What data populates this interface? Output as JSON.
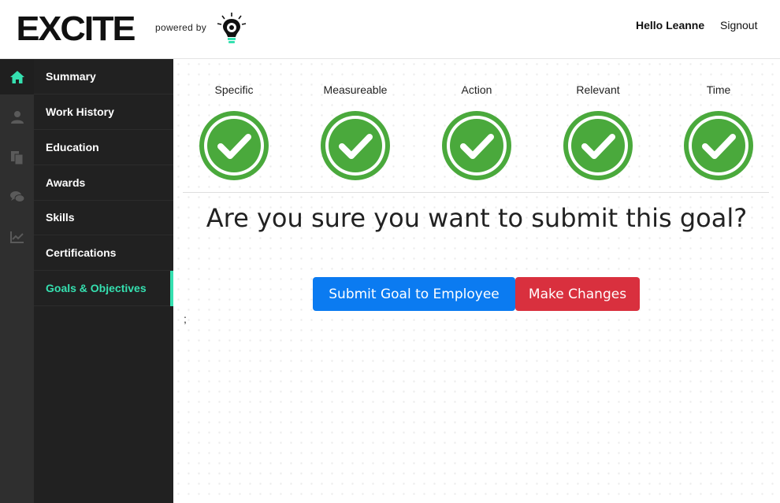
{
  "header": {
    "logo": "EXCITE",
    "powered_by": "powered by",
    "greeting": "Hello Leanne",
    "signout": "Signout"
  },
  "icon_rail": [
    "home-icon",
    "user-icon",
    "copy-icon",
    "chat-icon",
    "chart-icon"
  ],
  "nav": {
    "items": [
      {
        "label": "Summary"
      },
      {
        "label": "Work History"
      },
      {
        "label": "Education"
      },
      {
        "label": "Awards"
      },
      {
        "label": "Skills"
      },
      {
        "label": "Certifications"
      },
      {
        "label": "Goals & Objectives",
        "active": true
      }
    ]
  },
  "criteria": [
    {
      "label": "Specific",
      "checked": true
    },
    {
      "label": "Measureable",
      "checked": true
    },
    {
      "label": "Action",
      "checked": true
    },
    {
      "label": "Relevant",
      "checked": true
    },
    {
      "label": "Time",
      "checked": true
    }
  ],
  "confirm": {
    "question": "Are you sure you want to submit this goal?",
    "submit_label": "Submit Goal to Employee",
    "changes_label": "Make Changes"
  },
  "stray_text": ";",
  "colors": {
    "accent": "#35e0b0",
    "check_green": "#4aa93c",
    "primary": "#0b7bf1",
    "danger": "#d9303e",
    "sidebar": "#212121",
    "rail": "#2f2f2f"
  }
}
